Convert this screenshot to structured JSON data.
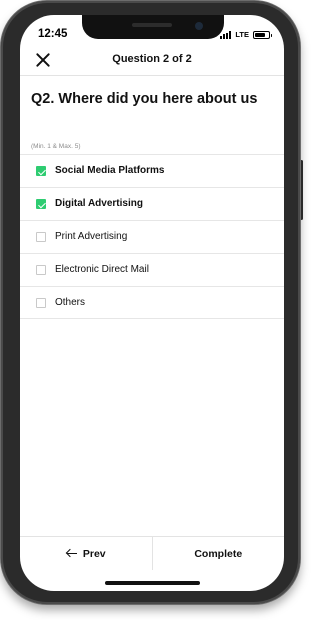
{
  "status_bar": {
    "time": "12:45",
    "network": "LTE",
    "battery_level": 0.8
  },
  "header": {
    "title": "Question 2 of 2",
    "close_icon": "close-icon"
  },
  "question": {
    "text": "Q2. Where did you here about us",
    "hint": "(Min. 1 & Max. 5)"
  },
  "options": [
    {
      "label": "Social Media Platforms",
      "checked": true
    },
    {
      "label": "Digital Advertising",
      "checked": true
    },
    {
      "label": "Print Advertising",
      "checked": false
    },
    {
      "label": "Electronic Direct Mail",
      "checked": false
    },
    {
      "label": "Others",
      "checked": false
    }
  ],
  "footer": {
    "prev_label": "Prev",
    "prev_icon": "arrow-left-icon",
    "complete_label": "Complete"
  },
  "colors": {
    "accent": "#2ecc71",
    "text": "#111111",
    "divider": "#e3e3e3"
  }
}
